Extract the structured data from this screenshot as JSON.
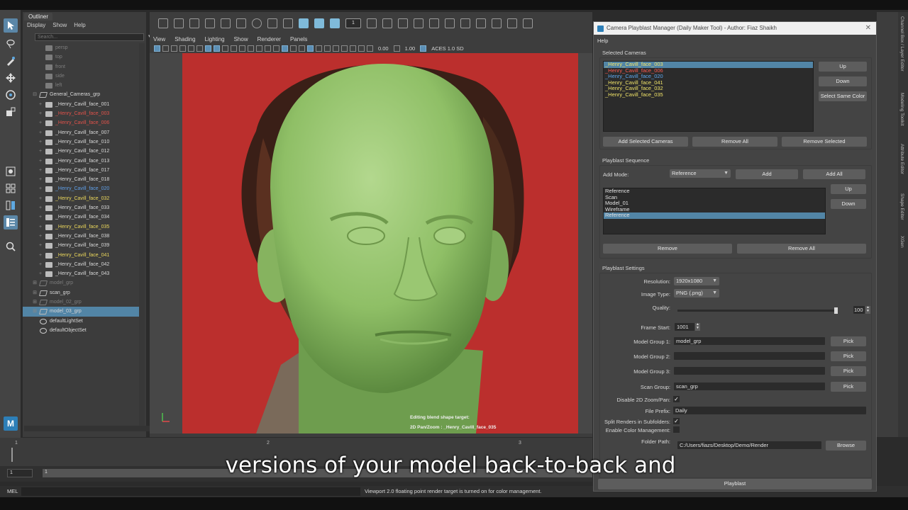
{
  "outliner": {
    "tab": "Outliner",
    "menu": [
      "Display",
      "Show",
      "Help"
    ],
    "search_placeholder": "Search...",
    "items": [
      {
        "label": "persp",
        "color": "dim",
        "indent": 2,
        "icon": "camera-icon"
      },
      {
        "label": "top",
        "color": "dim",
        "indent": 2,
        "icon": "camera-icon"
      },
      {
        "label": "front",
        "color": "dim",
        "indent": 2,
        "icon": "camera-icon"
      },
      {
        "label": "side",
        "color": "dim",
        "indent": 2,
        "icon": "camera-icon"
      },
      {
        "label": "left",
        "color": "dim",
        "indent": 2,
        "icon": "camera-icon"
      },
      {
        "label": "General_Cameras_grp",
        "color": "def",
        "indent": 1,
        "icon": "group-icon",
        "expander": "minus"
      },
      {
        "label": "_Henry_Cavill_face_001",
        "color": "def",
        "indent": 2,
        "icon": "camera-icon",
        "expander": "plus"
      },
      {
        "label": "_Henry_Cavill_face_003",
        "color": "red",
        "indent": 2,
        "icon": "camera-icon",
        "expander": "plus"
      },
      {
        "label": "_Henry_Cavill_face_006",
        "color": "red",
        "indent": 2,
        "icon": "camera-icon",
        "expander": "plus"
      },
      {
        "label": "_Henry_Cavill_face_007",
        "color": "def",
        "indent": 2,
        "icon": "camera-icon",
        "expander": "plus"
      },
      {
        "label": "_Henry_Cavill_face_010",
        "color": "def",
        "indent": 2,
        "icon": "camera-icon",
        "expander": "plus"
      },
      {
        "label": "_Henry_Cavill_face_012",
        "color": "def",
        "indent": 2,
        "icon": "camera-icon",
        "expander": "plus"
      },
      {
        "label": "_Henry_Cavill_face_013",
        "color": "def",
        "indent": 2,
        "icon": "camera-icon",
        "expander": "plus"
      },
      {
        "label": "_Henry_Cavill_face_017",
        "color": "def",
        "indent": 2,
        "icon": "camera-icon",
        "expander": "plus"
      },
      {
        "label": "_Henry_Cavill_face_018",
        "color": "def",
        "indent": 2,
        "icon": "camera-icon",
        "expander": "plus"
      },
      {
        "label": "_Henry_Cavill_face_020",
        "color": "blue",
        "indent": 2,
        "icon": "camera-icon",
        "expander": "plus"
      },
      {
        "label": "_Henry_Cavill_face_032",
        "color": "yellow",
        "indent": 2,
        "icon": "camera-icon",
        "expander": "plus"
      },
      {
        "label": "_Henry_Cavill_face_033",
        "color": "def",
        "indent": 2,
        "icon": "camera-icon",
        "expander": "plus"
      },
      {
        "label": "_Henry_Cavill_face_034",
        "color": "def",
        "indent": 2,
        "icon": "camera-icon",
        "expander": "plus"
      },
      {
        "label": "_Henry_Cavill_face_035",
        "color": "yellow",
        "indent": 2,
        "icon": "camera-icon",
        "expander": "plus"
      },
      {
        "label": "_Henry_Cavill_face_038",
        "color": "def",
        "indent": 2,
        "icon": "camera-icon",
        "expander": "plus"
      },
      {
        "label": "_Henry_Cavill_face_039",
        "color": "def",
        "indent": 2,
        "icon": "camera-icon",
        "expander": "plus"
      },
      {
        "label": "_Henry_Cavill_face_041",
        "color": "yellow",
        "indent": 2,
        "icon": "camera-icon",
        "expander": "plus"
      },
      {
        "label": "_Henry_Cavill_face_042",
        "color": "def",
        "indent": 2,
        "icon": "camera-icon",
        "expander": "plus"
      },
      {
        "label": "_Henry_Cavill_face_043",
        "color": "def",
        "indent": 2,
        "icon": "camera-icon",
        "expander": "plus"
      },
      {
        "label": "model_grp",
        "color": "dim",
        "indent": 1,
        "icon": "group-icon",
        "expander": "plus"
      },
      {
        "label": "scan_grp",
        "color": "def",
        "indent": 1,
        "icon": "group-icon",
        "expander": "plus"
      },
      {
        "label": "model_02_grp",
        "color": "dim",
        "indent": 1,
        "icon": "group-icon",
        "expander": "plus"
      },
      {
        "label": "model_03_grp",
        "color": "def",
        "indent": 1,
        "icon": "group-icon",
        "expander": "plus",
        "selected": true
      },
      {
        "label": "defaultLightSet",
        "color": "def",
        "indent": 1,
        "icon": "set-icon"
      },
      {
        "label": "defaultObjectSet",
        "color": "def",
        "indent": 1,
        "icon": "set-icon"
      }
    ]
  },
  "toolbar": {
    "frame_field": "1"
  },
  "viewport": {
    "menu": [
      "View",
      "Shading",
      "Lighting",
      "Show",
      "Renderer",
      "Panels"
    ],
    "exposure": "0.00",
    "gamma": "1.00",
    "color_space": "ACES 1.0 SD",
    "hud_line1": "Editing blend shape target:",
    "hud_line2": "2D Pan/Zoom : _Henry_Cavill_face_035"
  },
  "timeline": {
    "ticks": [
      "1",
      "2",
      "3"
    ],
    "start_field": "1",
    "range_start": "1"
  },
  "status": {
    "mel_label": "MEL",
    "message": "Viewport 2.0 floating point render target is turned on for color management."
  },
  "subtitle": "versions of your model back-to-back and",
  "right_tabs": [
    "Channel Box / Layer Editor",
    "Modeling Toolkit",
    "Attribute Editor",
    "Shape Editor",
    "XGen"
  ],
  "dialog": {
    "title": "Camera Playblast Manager (Daily Maker Tool) - Author: Fiaz Shaikh",
    "help": "Help",
    "selected_cameras": {
      "label": "Selected Cameras",
      "items": [
        {
          "label": "_Henry_Cavill_face_003",
          "color": "y",
          "selected": true
        },
        {
          "label": "_Henry_Cavill_face_006",
          "color": "r"
        },
        {
          "label": "_Henry_Cavill_face_020",
          "color": "b"
        },
        {
          "label": "_Henry_Cavill_face_041",
          "color": "y"
        },
        {
          "label": "_Henry_Cavill_face_032",
          "color": "y"
        },
        {
          "label": "_Henry_Cavill_face_035",
          "color": "y"
        }
      ],
      "up": "Up",
      "down": "Down",
      "select_same_color": "Select Same Color",
      "add_selected": "Add Selected Cameras",
      "remove_all": "Remove All",
      "remove_selected": "Remove Selected"
    },
    "sequence": {
      "label": "Playblast Sequence",
      "add_mode_label": "Add Mode:",
      "add_mode_value": "Reference",
      "add": "Add",
      "add_all": "Add All",
      "items": [
        {
          "label": "Reference"
        },
        {
          "label": "Scan"
        },
        {
          "label": "Model_01"
        },
        {
          "label": "Wireframe"
        },
        {
          "label": "Reference",
          "selected": true
        }
      ],
      "up": "Up",
      "down": "Down",
      "remove": "Remove",
      "remove_all": "Remove All"
    },
    "settings": {
      "label": "Playblast Settings",
      "resolution_label": "Resolution:",
      "resolution_value": "1920x1080",
      "image_type_label": "Image Type:",
      "image_type_value": "PNG (.png)",
      "quality_label": "Quality:",
      "quality_value": "100",
      "quality_fraction": 1.0,
      "frame_start_label": "Frame Start:",
      "frame_start_value": "1001",
      "model_group_1_label": "Model Group 1:",
      "model_group_1_value": "model_grp",
      "model_group_2_label": "Model Group 2:",
      "model_group_2_value": "",
      "model_group_3_label": "Model Group 3:",
      "model_group_3_value": "",
      "scan_group_label": "Scan Group:",
      "scan_group_value": "scan_grp",
      "pick": "Pick",
      "disable_2d_label": "Disable 2D Zoom/Pan:",
      "disable_2d_checked": true,
      "file_prefix_label": "File Prefix:",
      "file_prefix_value": "Daily",
      "split_renders_label": "Split Renders in Subfolders:",
      "split_renders_checked": true,
      "color_mgmt_label": "Enable Color Management:",
      "color_mgmt_checked": false,
      "folder_path_label": "Folder Path:",
      "folder_path_value": "C:/Users/fiazs/Desktop/Demo/Render",
      "browse": "Browse"
    },
    "playblast": "Playblast"
  }
}
